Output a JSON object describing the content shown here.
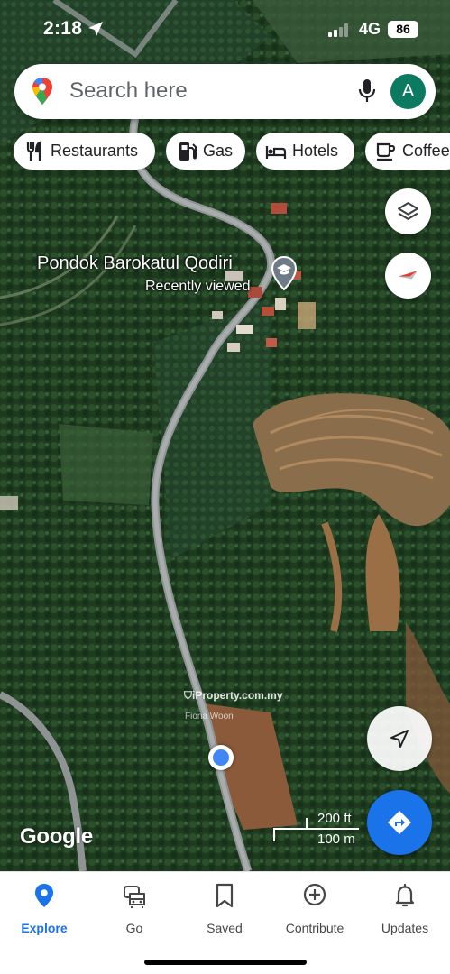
{
  "status_bar": {
    "time": "2:18",
    "network": "4G",
    "battery": "86"
  },
  "search": {
    "placeholder": "Search here",
    "avatar_initial": "A"
  },
  "chips": [
    {
      "label": "Restaurants",
      "icon": "utensils-icon"
    },
    {
      "label": "Gas",
      "icon": "gas-pump-icon"
    },
    {
      "label": "Hotels",
      "icon": "bed-icon"
    },
    {
      "label": "Coffee",
      "icon": "coffee-cup-icon"
    }
  ],
  "map": {
    "place_name": "Pondok Barokatul Qodiri",
    "place_subtitle": "Recently viewed",
    "watermark": "iProperty.com.my",
    "watermark_author": "Fiona Woon",
    "logo": "Google",
    "scale_ft": "200 ft",
    "scale_m": "100 m"
  },
  "bottom_nav": [
    {
      "label": "Explore",
      "icon": "pin-icon",
      "active": true
    },
    {
      "label": "Go",
      "icon": "car-icon",
      "active": false
    },
    {
      "label": "Saved",
      "icon": "bookmark-icon",
      "active": false
    },
    {
      "label": "Contribute",
      "icon": "plus-circle-icon",
      "active": false
    },
    {
      "label": "Updates",
      "icon": "bell-icon",
      "active": false
    }
  ],
  "colors": {
    "accent": "#1a73e8",
    "avatar": "#0b7a60",
    "forest": "#1f3d22"
  }
}
